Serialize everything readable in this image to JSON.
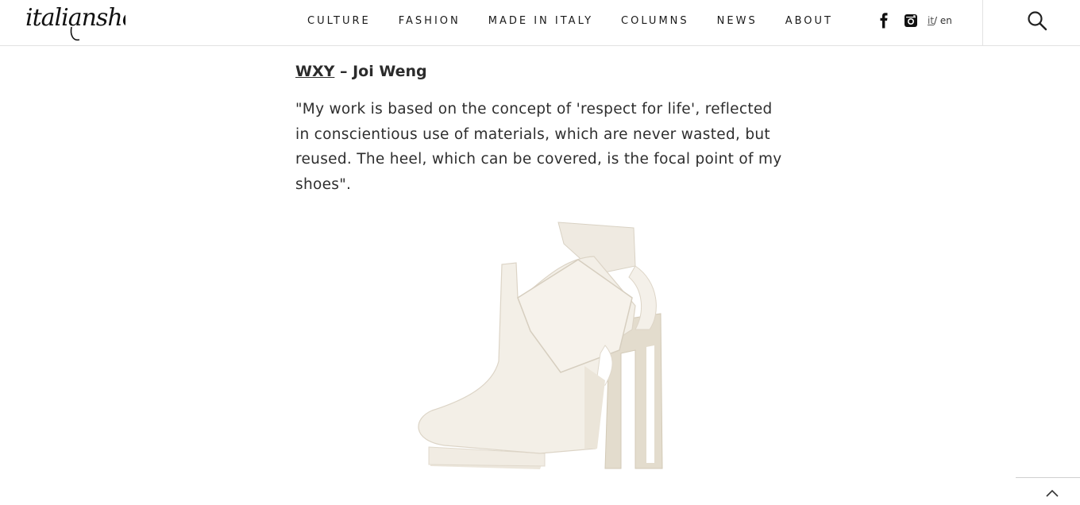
{
  "header": {
    "logo_text": "italianshoes",
    "nav": [
      {
        "label": "CULTURE"
      },
      {
        "label": "FASHION"
      },
      {
        "label": "MADE IN ITALY"
      },
      {
        "label": "COLUMNS"
      },
      {
        "label": "NEWS"
      },
      {
        "label": "ABOUT"
      }
    ],
    "social_icons": [
      "facebook-icon",
      "instagram-icon"
    ],
    "lang": {
      "it": "it",
      "separator": "/ ",
      "en": "en"
    },
    "search_icon": "search-icon"
  },
  "article": {
    "brand": "WXY",
    "title_rest": " – Joi Weng",
    "quote": "\"My work is based on the concept of 'respect for life', reflected in conscientious use of materials, which are never wasted, but reused. The heel, which can be covered, is the focal point of my shoes\"."
  },
  "back_to_top_icon": "chevron-up-icon"
}
